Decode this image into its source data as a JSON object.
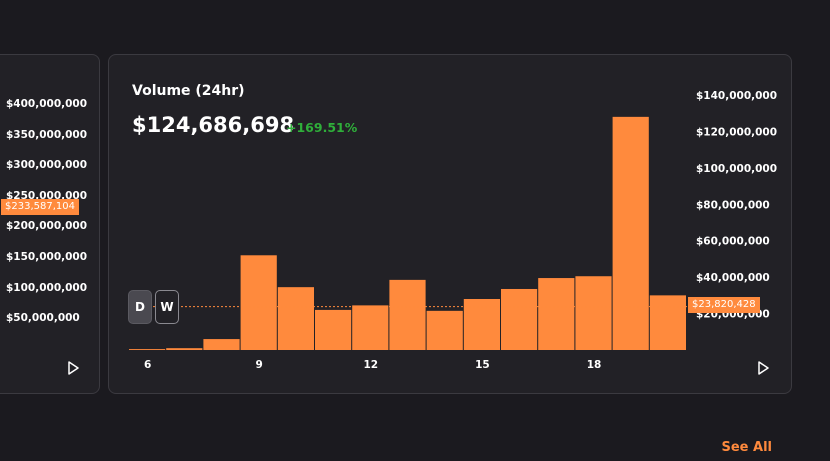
{
  "left_panel": {
    "y_ticks": [
      "$400,000,000",
      "$350,000,000",
      "$300,000,000",
      "$250,000,000",
      "$200,000,000",
      "$150,000,000",
      "$100,000,000",
      "$50,000,000"
    ],
    "current_price_label": "$233,587,104"
  },
  "volume_panel": {
    "title": "Volume (24hr)",
    "value": "$124,686,698",
    "change": "+169.51%",
    "current_price_label": "$23,820,428",
    "buttons": {
      "day": "D",
      "week": "W"
    }
  },
  "see_all": "See All",
  "colors": {
    "bar": "#ff8a3d",
    "positive": "#2fae3a",
    "background": "#1b1a1f",
    "card": "#222126"
  },
  "chart_data": {
    "type": "bar",
    "title": "Volume (24hr)",
    "x": [
      6,
      7,
      8,
      9,
      10,
      11,
      12,
      13,
      14,
      15,
      16,
      17,
      18,
      19,
      20
    ],
    "values": [
      500000,
      1000000,
      6000000,
      52000000,
      34500000,
      22000000,
      24500000,
      38500000,
      21500000,
      28000000,
      33500000,
      39500000,
      40500000,
      128000000,
      30000000
    ],
    "x_tick_labels": [
      "6",
      "9",
      "12",
      "15",
      "18"
    ],
    "x_tick_values": [
      6,
      9,
      12,
      15,
      18
    ],
    "y_tick_labels": [
      "$140,000,000",
      "$120,000,000",
      "$100,000,000",
      "$80,000,000",
      "$60,000,000",
      "$40,000,000",
      "$20,000,000"
    ],
    "y_tick_values": [
      140000000,
      120000000,
      100000000,
      80000000,
      60000000,
      40000000,
      20000000
    ],
    "ylim": [
      0,
      140000000
    ],
    "reference_line": 23820428,
    "grid": false
  }
}
